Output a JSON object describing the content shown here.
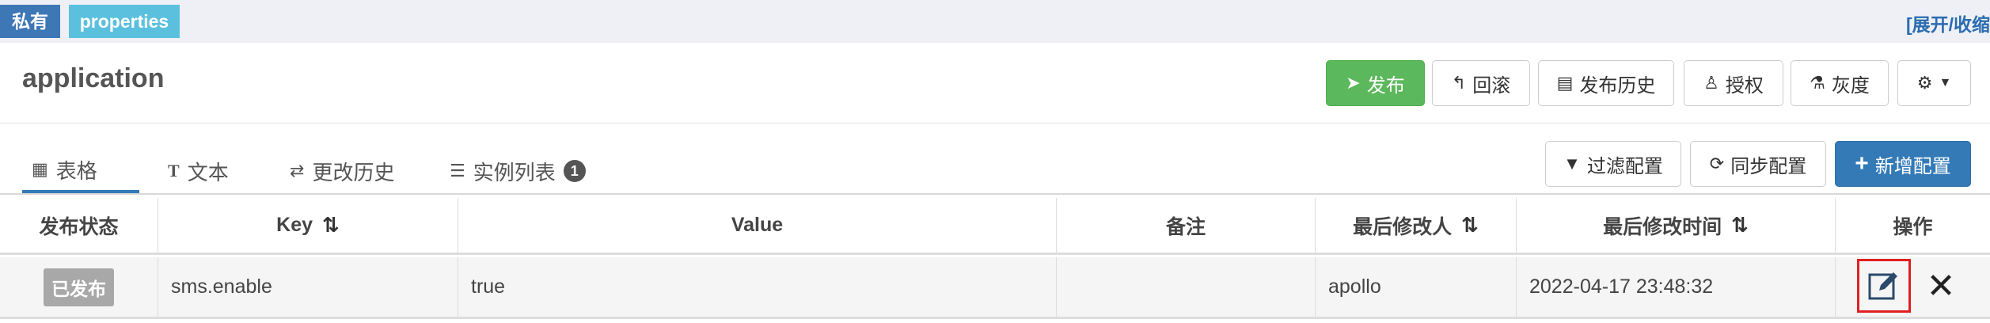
{
  "topbar": {
    "tag_private": "私有",
    "tag_format": "properties",
    "expand_link": "[展开/收缩"
  },
  "header": {
    "app_name": "application",
    "buttons": {
      "publish": "发布",
      "rollback": "回滚",
      "history": "发布历史",
      "authorize": "授权",
      "gray": "灰度"
    }
  },
  "tabs": [
    {
      "label": "表格",
      "icon": "table-icon"
    },
    {
      "label": "文本",
      "icon": "text-icon"
    },
    {
      "label": "更改历史",
      "icon": "history-icon"
    },
    {
      "label": "实例列表",
      "icon": "instance-list-icon",
      "badge": "1"
    }
  ],
  "actions": {
    "filter": "过滤配置",
    "sync": "同步配置",
    "add": "新增配置"
  },
  "table": {
    "columns": [
      "发布状态",
      "Key",
      "Value",
      "备注",
      "最后修改人",
      "最后修改时间",
      "操作"
    ],
    "rows": [
      {
        "status": "已发布",
        "key": "sms.enable",
        "value": "true",
        "comment": "",
        "modifier": "apollo",
        "modified_time": "2022-04-17 23:48:32"
      }
    ]
  },
  "colors": {
    "primary": "#337ab7",
    "success": "#5cb85c",
    "info": "#5bc0de",
    "highlight": "#e02020"
  }
}
